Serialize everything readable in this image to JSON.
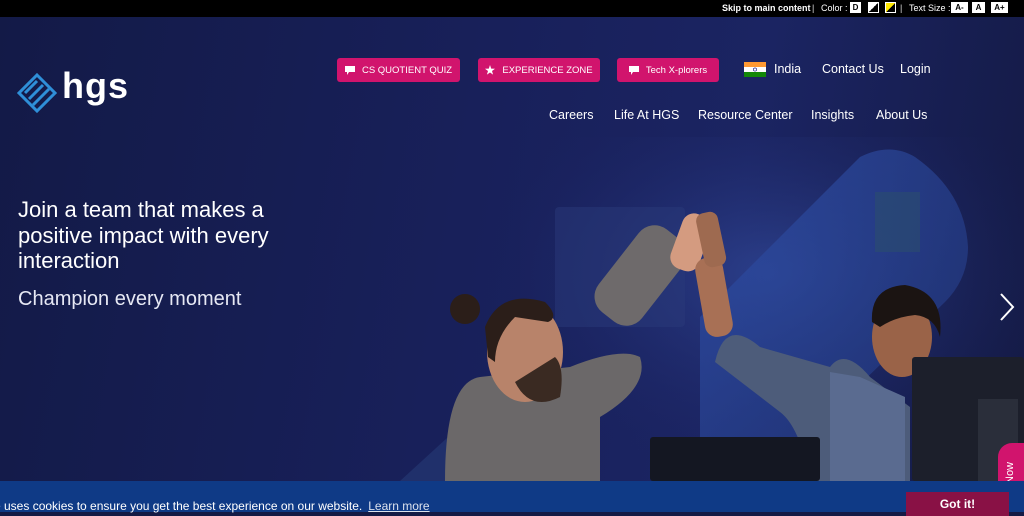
{
  "topbar": {
    "skip_label": "Skip to main content",
    "color_label": "Color :",
    "color_default": "D",
    "text_size_label": "Text Size :",
    "text_sizes": [
      "A-",
      "A",
      "A+"
    ]
  },
  "brand": {
    "logo_text": "hgs",
    "accent": "#d1146d",
    "logo_blue": "#2f8fd8"
  },
  "pills": [
    {
      "label": "CS QUOTIENT QUIZ",
      "icon": "chat-icon"
    },
    {
      "label": "EXPERIENCE ZONE",
      "icon": "star-icon"
    },
    {
      "label": "Tech X-plorers",
      "icon": "chat-icon"
    }
  ],
  "utility_nav": {
    "country": "India",
    "contact": "Contact Us",
    "login": "Login"
  },
  "main_nav": [
    "Careers",
    "Life At HGS",
    "Resource Center",
    "Insights",
    "About Us"
  ],
  "hero": {
    "headline": "Join a team that makes a positive impact with every interaction",
    "subheadline": "Champion every moment"
  },
  "apply_tab": {
    "label": "ly Now"
  },
  "cookie": {
    "message": "e uses cookies to ensure you get the best experience on our website.",
    "learn_more": "Learn more",
    "accept": "Got it!"
  }
}
